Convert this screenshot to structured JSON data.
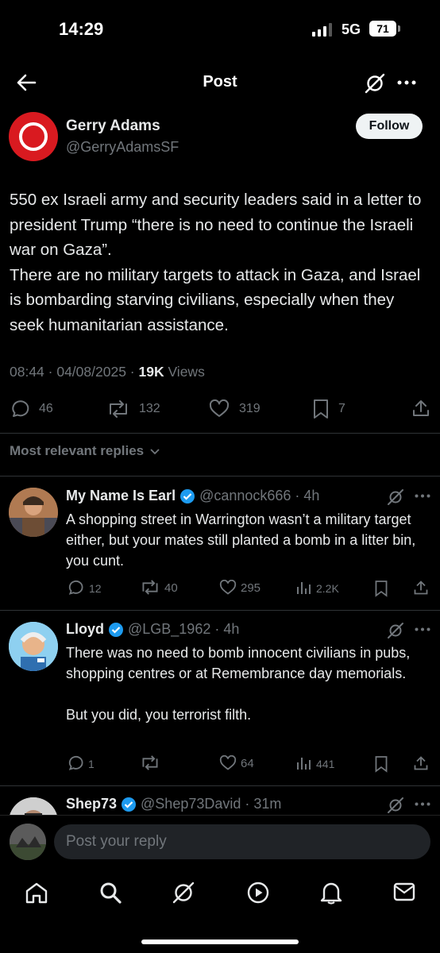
{
  "status": {
    "time": "14:29",
    "network": "5G",
    "battery": "71"
  },
  "header": {
    "title": "Post"
  },
  "post": {
    "author_name": "Gerry Adams",
    "author_handle": "@GerryAdamsSF",
    "follow_label": "Follow",
    "text": "550 ex Israeli army and security leaders said in a letter to president Trump “there is no need to continue the Israeli war on Gaza”.\nThere are no military targets to attack in Gaza, and Israel is bombarding starving civilians, especially when they seek humanitarian assistance.",
    "timestamp": "08:44 · 04/08/2025 · ",
    "views_count": "19K",
    "views_label": " Views",
    "replies": "46",
    "reposts": "132",
    "likes": "319",
    "bookmarks": "7"
  },
  "replies_section": {
    "label": "Most relevant replies"
  },
  "replies": [
    {
      "name": "My Name Is Earl",
      "handle": "@cannock666 · 4h",
      "text": "A shopping street in Warrington wasn’t a military target either, but your mates still planted a bomb in a litter bin, you cunt.",
      "replies": "12",
      "reposts": "40",
      "likes": "295",
      "views": "2.2K"
    },
    {
      "name": "Lloyd",
      "handle": "@LGB_1962 · 4h",
      "text": "There was no need to bomb innocent civilians in pubs, shopping centres or at Remembrance day memorials.\n\nBut you did, you terrorist filth.",
      "replies": "1",
      "reposts": "",
      "likes": "64",
      "views": "441"
    },
    {
      "name": "Shep73",
      "handle": "@Shep73David · 31m"
    }
  ],
  "composer": {
    "placeholder": "Post your reply"
  },
  "colors": {
    "accent": "#1d9bf0",
    "background": "#000000",
    "muted": "#71767b",
    "text": "#e7e9ea"
  },
  "icons": [
    "back-arrow-icon",
    "grok-icon",
    "more-icon",
    "reply-icon",
    "repost-icon",
    "like-icon",
    "bookmark-icon",
    "share-icon",
    "views-icon",
    "verified-icon",
    "home-icon",
    "search-icon",
    "notifications-icon",
    "messages-icon",
    "video-icon"
  ]
}
